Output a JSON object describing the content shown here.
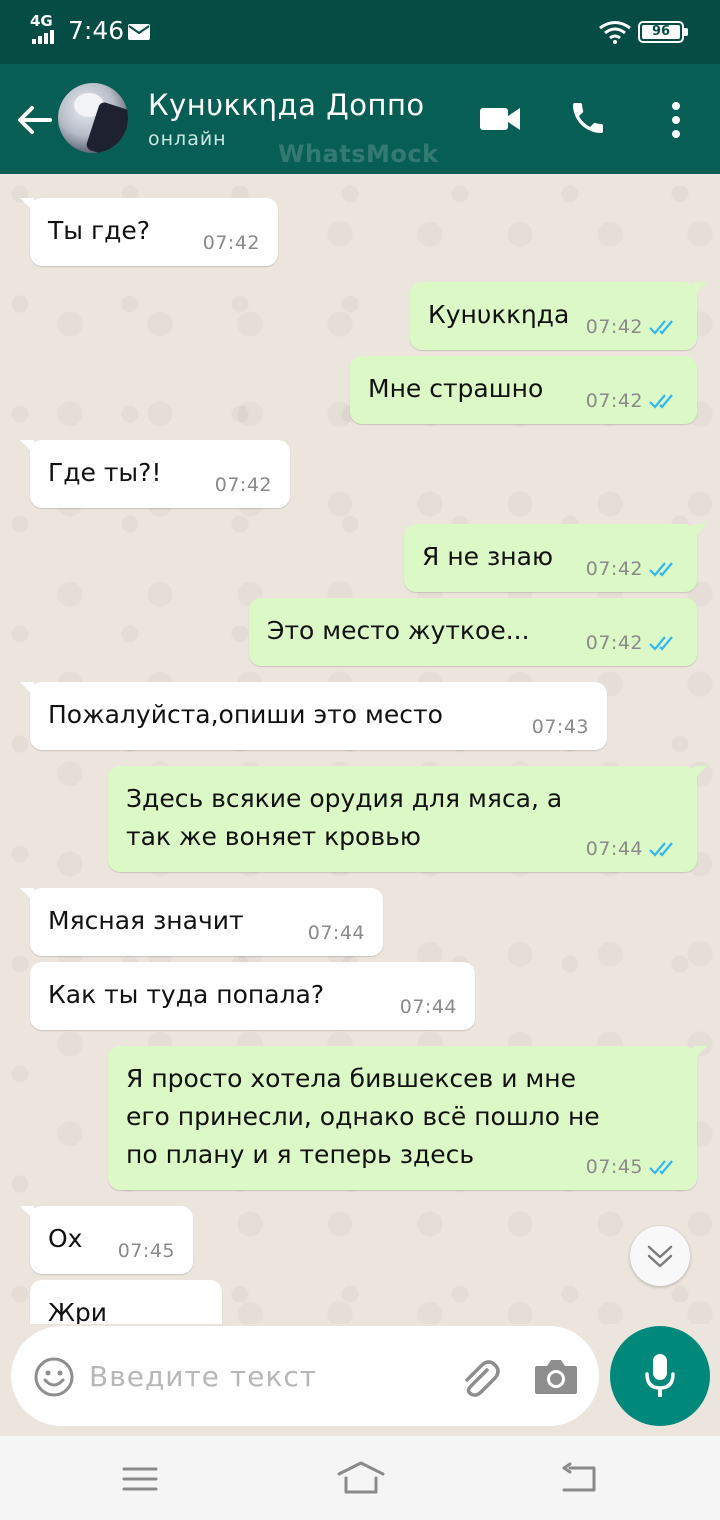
{
  "status_bar": {
    "network": "4G",
    "time": "7:46",
    "battery": "96"
  },
  "header": {
    "contact_name": "Кунυκκηда Доппо",
    "status": "онлайн",
    "watermark": "WhatsMock"
  },
  "messages": [
    {
      "dir": "in",
      "text": "Ты где?",
      "time": "07:42"
    },
    {
      "dir": "out",
      "text": "Кунυκκηда",
      "time": "07:42"
    },
    {
      "dir": "out",
      "text": "Мне страшно",
      "time": "07:42"
    },
    {
      "dir": "in",
      "text": "Где ты?!",
      "time": "07:42"
    },
    {
      "dir": "out",
      "text": "Я не знаю",
      "time": "07:42"
    },
    {
      "dir": "out",
      "text": "Это место жуткое...",
      "time": "07:42"
    },
    {
      "dir": "in",
      "text": "Пожалуйста,опиши это место",
      "time": "07:43"
    },
    {
      "dir": "out",
      "text": "Здесь всякие орудия для мяса, а\nтак же воняет кровью",
      "time": "07:44"
    },
    {
      "dir": "in",
      "text": "Мясная значит",
      "time": "07:44"
    },
    {
      "dir": "in",
      "text": "Как ты туда попала?",
      "time": "07:44"
    },
    {
      "dir": "out",
      "text": "Я просто хотела бившексев и мне\nего принесли, однако всё пошло не\nпо плану и я теперь здесь",
      "time": "07:45"
    },
    {
      "dir": "in",
      "text": "Ох",
      "time": "07:45"
    },
    {
      "dir": "in",
      "text": "Жри",
      "time": ""
    }
  ],
  "composer": {
    "placeholder": "Введите текст"
  },
  "colors": {
    "status_bar": "#054d44",
    "app_bar": "#075e54",
    "incoming": "#ffffff",
    "outgoing": "#dcf8c6",
    "tick": "#34b7f1",
    "mic": "#00897b"
  }
}
